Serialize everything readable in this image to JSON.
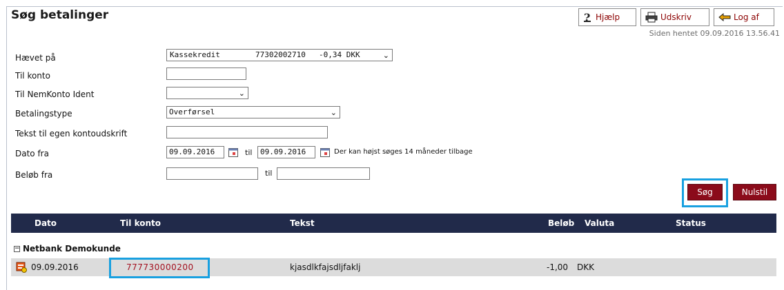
{
  "header": {
    "title": "Søg betalinger",
    "help_label": "Hjælp",
    "print_label": "Udskriv",
    "logout_label": "Log af",
    "fetched_text": "Siden hentet 09.09.2016 13.56.41"
  },
  "form": {
    "haevet_paa": {
      "label": "Hævet på",
      "account_name": "Kassekredit",
      "account_number": "77302002710",
      "balance": "-0,34 DKK"
    },
    "til_konto": {
      "label": "Til konto",
      "value": ""
    },
    "nemkonto": {
      "label": "Til NemKonto Ident",
      "value": ""
    },
    "betalingstype": {
      "label": "Betalingstype",
      "value": "Overførsel"
    },
    "tekst": {
      "label": "Tekst til egen kontoudskrift",
      "value": ""
    },
    "dato": {
      "label": "Dato fra",
      "from": "09.09.2016",
      "til_label": "til",
      "to": "09.09.2016",
      "note": "Der kan højst søges 14 måneder tilbage"
    },
    "beloeb": {
      "label": "Beløb fra",
      "from": "",
      "til_label": "til",
      "to": ""
    },
    "search_label": "Søg",
    "reset_label": "Nulstil"
  },
  "table": {
    "headers": {
      "dato": "Dato",
      "til_konto": "Til konto",
      "tekst": "Tekst",
      "beloeb": "Beløb",
      "valuta": "Valuta",
      "status": "Status"
    },
    "group_name": "Netbank Demokunde",
    "rows": [
      {
        "dato": "09.09.2016",
        "til_konto": "777730000200",
        "tekst": "kjasdlkfajsdljfaklj",
        "beloeb": "-1,00",
        "valuta": "DKK",
        "status": ""
      }
    ]
  },
  "colors": {
    "brand_red": "#8b0b1a",
    "header_navy": "#212a4a",
    "highlight": "#18a0e0"
  }
}
